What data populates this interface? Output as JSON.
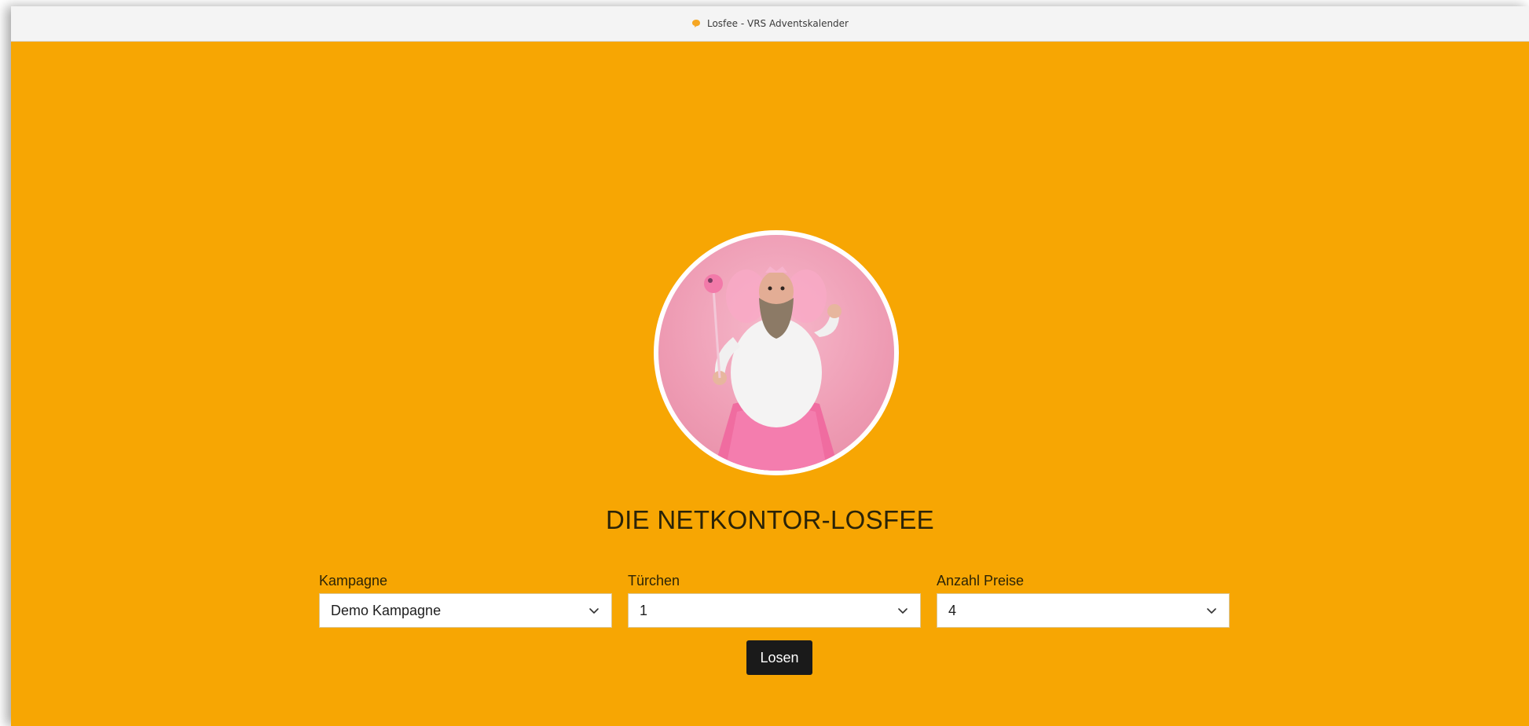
{
  "window": {
    "title": "Losfee - VRS Adventskalender",
    "icon": "speech-bubble-icon",
    "icon_color": "#f5a623"
  },
  "colors": {
    "background": "#f7a603",
    "button": "#1a1a1a",
    "avatar_border": "#ffffff"
  },
  "hero": {
    "image": "fairy-man-photo",
    "headline": "DIE NETKONTOR-LOSFEE"
  },
  "form": {
    "campaign": {
      "label": "Kampagne",
      "value": "Demo Kampagne"
    },
    "door": {
      "label": "Türchen",
      "value": "1"
    },
    "prizes": {
      "label": "Anzahl Preise",
      "value": "4"
    },
    "submit_label": "Losen"
  }
}
